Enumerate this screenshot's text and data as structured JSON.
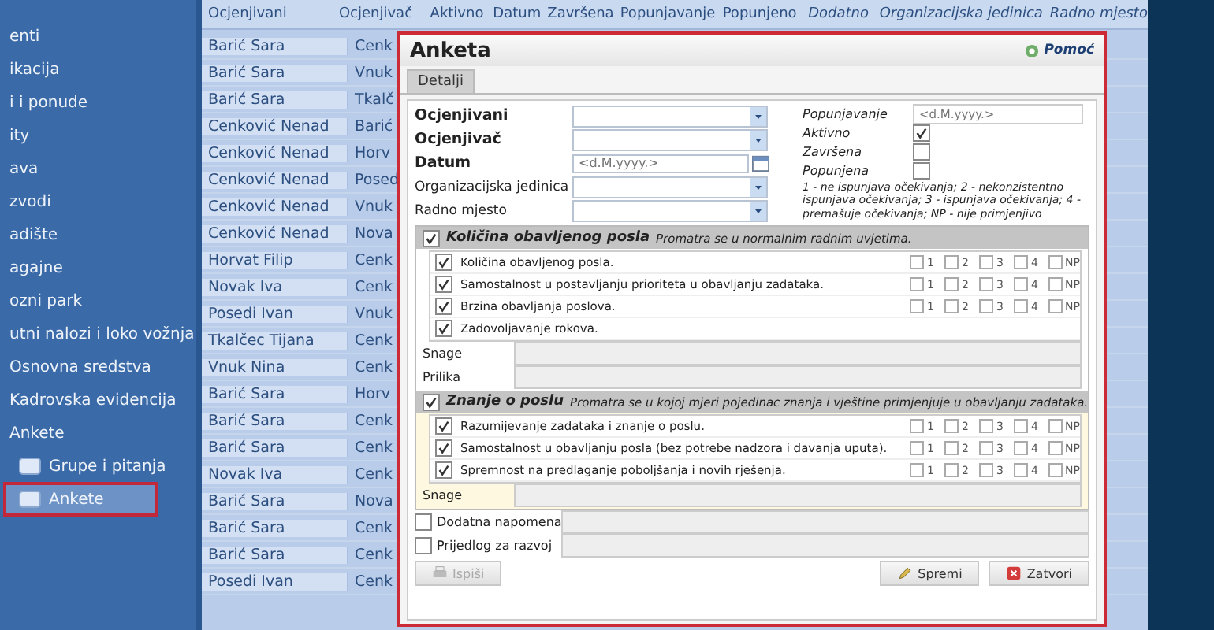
{
  "sidebar": {
    "items": [
      {
        "label": "enti",
        "kind": "item",
        "selected": false
      },
      {
        "label": "ikacija",
        "kind": "item",
        "selected": false
      },
      {
        "label": "i i ponude",
        "kind": "item",
        "selected": false
      },
      {
        "label": "ity",
        "kind": "item",
        "selected": false
      },
      {
        "label": "ava",
        "kind": "item",
        "selected": false
      },
      {
        "label": "zvodi",
        "kind": "item",
        "selected": false
      },
      {
        "label": "adište",
        "kind": "item",
        "selected": false
      },
      {
        "label": "agajne",
        "kind": "item",
        "selected": false
      },
      {
        "label": "ozni park",
        "kind": "item",
        "selected": false
      },
      {
        "label": "utni nalozi i loko vožnja",
        "kind": "item",
        "selected": false
      },
      {
        "label": "Osnovna sredstva",
        "kind": "item",
        "selected": false
      },
      {
        "label": "Kadrovska evidencija",
        "kind": "item",
        "selected": false
      },
      {
        "label": "Ankete",
        "kind": "item",
        "selected": false
      },
      {
        "label": "Grupe i pitanja",
        "kind": "sub",
        "selected": false
      },
      {
        "label": "Ankete",
        "kind": "sub",
        "selected": true
      }
    ]
  },
  "grid": {
    "columns": [
      "Ocjenjivani",
      "Ocjenjivač",
      "Aktivno",
      "Datum",
      "Završena",
      "Popunjavanje",
      "Popunjeno",
      "Dodatno",
      "Organizacijska jedinica",
      "Radno mjesto"
    ],
    "rows": [
      [
        "Barić Sara",
        "Cenk"
      ],
      [
        "Barić Sara",
        "Vnuk"
      ],
      [
        "Barić Sara",
        "Tkalč"
      ],
      [
        "Cenković Nenad",
        "Barić"
      ],
      [
        "Cenković Nenad",
        "Horv"
      ],
      [
        "Cenković Nenad",
        "Posed"
      ],
      [
        "Cenković Nenad",
        "Vnuk"
      ],
      [
        "Cenković Nenad",
        "Nova"
      ],
      [
        "Horvat Filip",
        "Cenk"
      ],
      [
        "Novak Iva",
        "Cenk"
      ],
      [
        "Posedi Ivan",
        "Vnuk"
      ],
      [
        "Tkalčec Tijana",
        "Cenk"
      ],
      [
        "Vnuk Nina",
        "Cenk"
      ],
      [
        "Barić Sara",
        "Horv"
      ],
      [
        "Barić Sara",
        "Cenk"
      ],
      [
        "Barić Sara",
        "Cenk"
      ],
      [
        "Novak Iva",
        "Cenk"
      ],
      [
        "Barić Sara",
        "Nova"
      ],
      [
        "Barić Sara",
        "Cenk"
      ],
      [
        "Barić Sara",
        "Cenk"
      ],
      [
        "Posedi Ivan",
        "Cenk"
      ]
    ]
  },
  "dialog": {
    "title": "Anketa",
    "help": "Pomoć",
    "tabs": [
      {
        "label": "Detalji",
        "selected": true
      }
    ],
    "fields": [
      {
        "label": "Ocjenjivani",
        "kind": "dropdown",
        "bold": true
      },
      {
        "label": "Ocjenjivač",
        "kind": "dropdown",
        "bold": true
      },
      {
        "label": "Datum",
        "kind": "date",
        "bold": true,
        "placeholder": "<d.M.yyyy.>"
      },
      {
        "label": "Organizacijska jedinica",
        "kind": "dropdown",
        "bold": false
      },
      {
        "label": "Radno mjesto",
        "kind": "dropdown",
        "bold": false
      }
    ],
    "options": [
      {
        "label": "Popunjavanje",
        "kind": "date",
        "placeholder": "<d.M.yyyy.>"
      },
      {
        "label": "Aktivno",
        "kind": "checkbox",
        "checked": true
      },
      {
        "label": "Završena",
        "kind": "checkbox",
        "checked": false
      },
      {
        "label": "Popunjena",
        "kind": "checkbox",
        "checked": false
      }
    ],
    "legend": "1 - ne ispunjava očekivanja; 2 - nekonzistentno ispunjava očekivanja; 3 - ispunjava očekivanja; 4 - premašuje očekivanja; NP - nije primjenjivo",
    "sections": [
      {
        "title": "Količina obavljenog posla",
        "description": "Promatra se u normalnim radnim uvjetima.",
        "checked": true,
        "selected": false,
        "items": [
          {
            "label": "Količina obavljenog posla.",
            "checked": true,
            "ratings": [
              {
                "label": "1",
                "checked": false
              },
              {
                "label": "2",
                "checked": false
              },
              {
                "label": "3",
                "checked": false
              },
              {
                "label": "4",
                "checked": false
              },
              {
                "label": "NP",
                "checked": false
              }
            ]
          },
          {
            "label": "Samostalnost u postavljanju prioriteta u obavljanju zadataka.",
            "checked": true,
            "ratings": [
              {
                "label": "1",
                "checked": false
              },
              {
                "label": "2",
                "checked": false
              },
              {
                "label": "3",
                "checked": false
              },
              {
                "label": "4",
                "checked": false
              },
              {
                "label": "NP",
                "checked": false
              }
            ]
          },
          {
            "label": "Brzina obavljanja poslova.",
            "checked": true,
            "ratings": [
              {
                "label": "1",
                "checked": false
              },
              {
                "label": "2",
                "checked": false
              },
              {
                "label": "3",
                "checked": false
              },
              {
                "label": "4",
                "checked": false
              },
              {
                "label": "NP",
                "checked": false
              }
            ]
          },
          {
            "label": "Zadovoljavanje rokova.",
            "checked": true
          }
        ],
        "notes": [
          "Snage",
          "Prilika"
        ]
      },
      {
        "title": "Znanje o poslu",
        "description": "Promatra se u kojoj mjeri pojedinac znanja i vještine primjenjuje u obavljanju zadataka.",
        "checked": true,
        "selected": true,
        "items": [
          {
            "label": "Razumijevanje zadataka i znanje o poslu.",
            "checked": true,
            "ratings": [
              {
                "label": "1",
                "checked": false
              },
              {
                "label": "2",
                "checked": false
              },
              {
                "label": "3",
                "checked": false
              },
              {
                "label": "4",
                "checked": false
              },
              {
                "label": "NP",
                "checked": false
              }
            ]
          },
          {
            "label": "Samostalnost u obavljanju posla (bez potrebe nadzora i davanja uputa).",
            "checked": true,
            "ratings": [
              {
                "label": "1",
                "checked": false
              },
              {
                "label": "2",
                "checked": false
              },
              {
                "label": "3",
                "checked": false
              },
              {
                "label": "4",
                "checked": false
              },
              {
                "label": "NP",
                "checked": false
              }
            ]
          },
          {
            "label": "Spremnost na predlaganje poboljšanja i novih rješenja.",
            "checked": true,
            "ratings": [
              {
                "label": "1",
                "checked": false
              },
              {
                "label": "2",
                "checked": false
              },
              {
                "label": "3",
                "checked": false
              },
              {
                "label": "4",
                "checked": false
              },
              {
                "label": "NP",
                "checked": false
              }
            ]
          }
        ],
        "notes": [
          "Snage"
        ]
      }
    ],
    "extras": [
      {
        "label": "Dodatna napomena",
        "checked": false
      },
      {
        "label": "Prijedlog za razvoj",
        "checked": false
      }
    ],
    "print_button": {
      "label": "Ispiši",
      "disabled": true
    },
    "buttons": [
      {
        "label": "Spremi",
        "kind": "save"
      },
      {
        "label": "Zatvori",
        "kind": "close"
      }
    ]
  }
}
